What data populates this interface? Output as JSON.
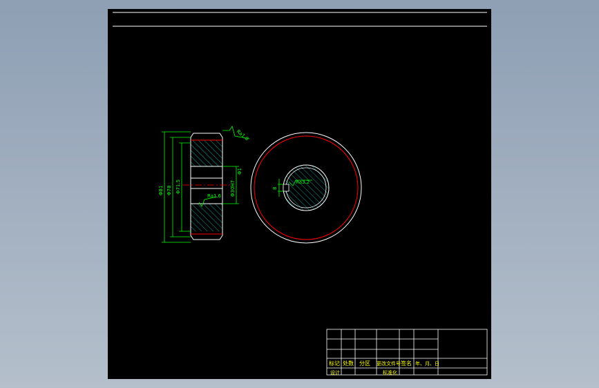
{
  "colors": {
    "background": "#000000",
    "outline": "#ffffff",
    "dimension": "#00ff00",
    "section_hatch": "#00c8c8",
    "pitch_circle": "#ff0000",
    "title_block_text": "#ffff00"
  },
  "drawing": {
    "front_view": {
      "dim_outer_diameter": "Φ81",
      "dim_pitch_diameter": "Φ78",
      "dim_root_diameter": "Φ71.5",
      "dim_bore": "Φ30H7",
      "dim_bore_tail": "Φ1",
      "roughness_top": "Ra1.6",
      "roughness_bore": "Ra1.6"
    },
    "side_view": {
      "roughness_keyway": "Ra3.2",
      "dim_keyway": "8"
    }
  },
  "title_block": {
    "row_labels": [
      "标记",
      "处数",
      "分区",
      "更改文件号",
      "签名",
      "年、月、日"
    ],
    "bottom_labels": [
      "设计",
      "标准化"
    ]
  }
}
